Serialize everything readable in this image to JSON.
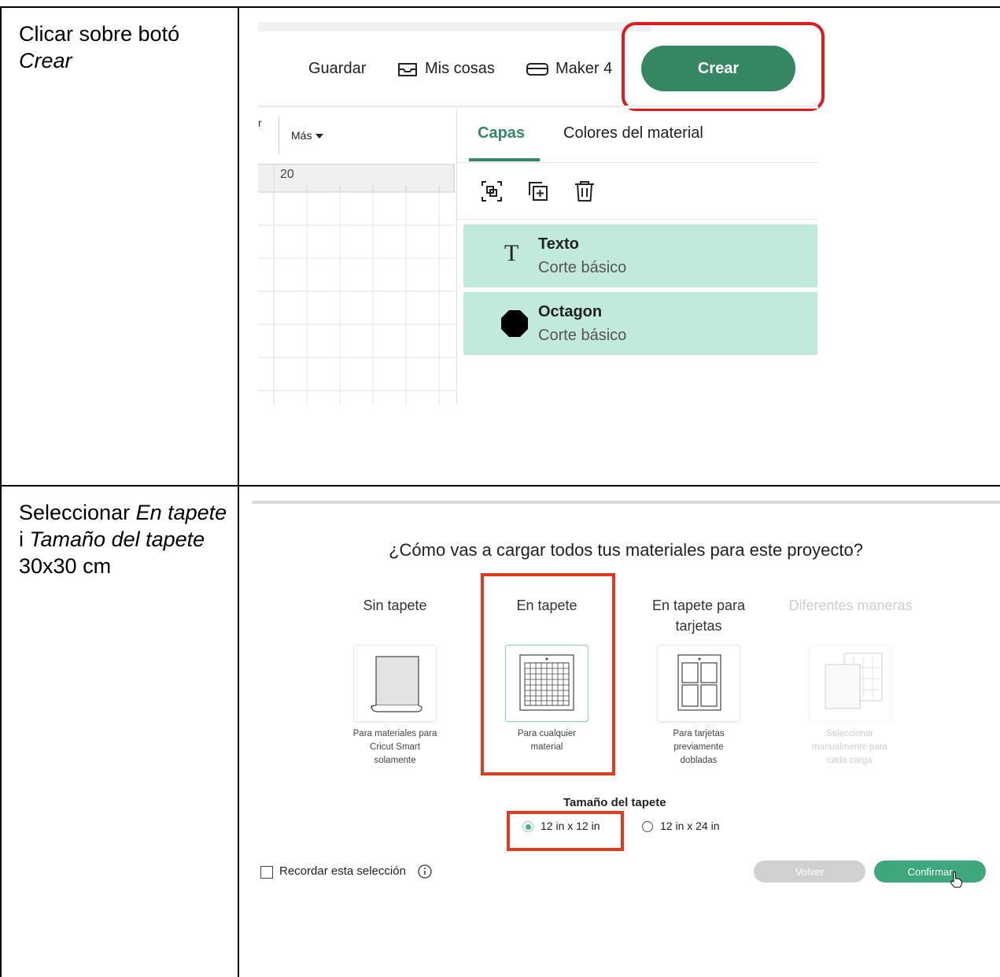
{
  "rows": [
    {
      "text_parts": [
        {
          "t": "Clicar sobre botó ",
          "i": false
        },
        {
          "t": "Crear",
          "i": true
        }
      ]
    },
    {
      "text_parts": [
        {
          "t": "Seleccionar ",
          "i": false
        },
        {
          "t": "En tapete",
          "i": true
        },
        {
          "t": " i ",
          "i": false
        },
        {
          "t": "Tamaño del tapete",
          "i": true
        },
        {
          "t": " 30x30 cm",
          "i": false
        }
      ]
    }
  ],
  "shot1": {
    "toolbar": {
      "save": "Guardar",
      "my_stuff": "Mis cosas",
      "machine": "Maker 4",
      "make": "Crear"
    },
    "canvas": {
      "more": "Más",
      "ruler_value": "20",
      "clipped_letter": "r"
    },
    "tabs": {
      "layers": "Capas",
      "material_colors": "Colores del material"
    },
    "layers": [
      {
        "name": "Texto",
        "operation": "Corte básico",
        "icon": "text-t-icon"
      },
      {
        "name": "Octagon",
        "operation": "Corte básico",
        "icon": "octagon-icon"
      }
    ],
    "colors": {
      "accent": "#358762",
      "highlight": "#e01b1b",
      "layer_bg": "#c2eadb"
    }
  },
  "shot2": {
    "question": "¿Cómo vas a cargar todos tus materiales para este proyecto?",
    "options": [
      {
        "label": "Sin tapete",
        "desc": "Para materiales para Cricut Smart solamente",
        "enabled": true
      },
      {
        "label": "En tapete",
        "desc": "Para cualquier material",
        "enabled": true,
        "selected": true
      },
      {
        "label": "En tapete para tarjetas",
        "desc": "Para tarjetas previamente dobladas",
        "enabled": true
      },
      {
        "label": "Diferentes maneras",
        "desc": "Seleccionar manualmente para cada carga",
        "enabled": false
      }
    ],
    "mat_size_title": "Tamaño del tapete",
    "mat_sizes": [
      {
        "label": "12 in x 12 in",
        "selected": true
      },
      {
        "label": "12 in x 24 in",
        "selected": false
      }
    ],
    "remember": "Recordar esta selección",
    "back": "Volver",
    "confirm": "Confirmar"
  }
}
